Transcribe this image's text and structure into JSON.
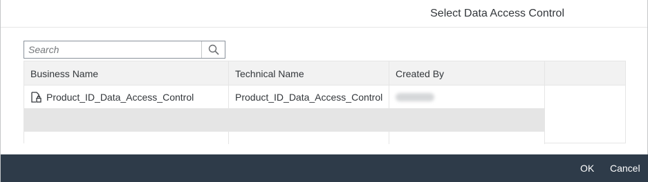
{
  "dialog": {
    "title": "Select Data Access Control"
  },
  "search": {
    "placeholder": "Search",
    "value": ""
  },
  "table": {
    "columns": [
      "Business Name",
      "Technical Name",
      "Created By"
    ],
    "rows": [
      {
        "business_name": "Product_ID_Data_Access_Control",
        "technical_name": "Product_ID_Data_Access_Control",
        "created_by": ""
      }
    ]
  },
  "footer": {
    "ok_label": "OK",
    "cancel_label": "Cancel"
  },
  "colors": {
    "footer_bg": "#2e3b49",
    "header_bg": "#f2f2f2",
    "selected_row_bg": "#e5e5e5"
  },
  "icons": {
    "row_icon": "data-access-control-icon",
    "search": "search-icon"
  }
}
